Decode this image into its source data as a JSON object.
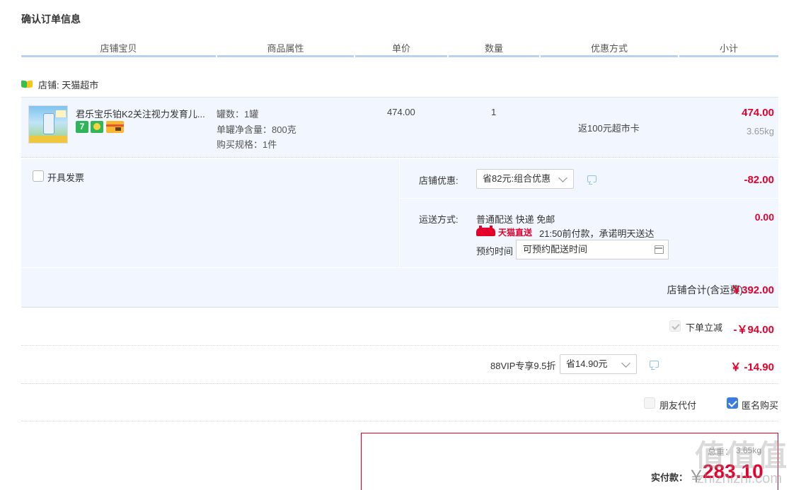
{
  "page_title": "确认订单信息",
  "columns": [
    "店铺宝贝",
    "商品属性",
    "单价",
    "数量",
    "优惠方式",
    "小计"
  ],
  "shop": {
    "label": "店铺: 天猫超市"
  },
  "item": {
    "title": "君乐宝乐铂K2关注视力发育儿...",
    "badge_text": "7",
    "attrs": [
      "罐数：1罐",
      "单罐净含量：800克",
      "购买规格：1件"
    ],
    "price": "474.00",
    "qty": "1",
    "promo": "返100元超市卡",
    "subtotal": "474.00",
    "weight": "3.65kg"
  },
  "invoice": {
    "label": "开具发票"
  },
  "shop_discount": {
    "label": "店铺优惠:",
    "select_value": "省82元:组合优惠",
    "amount": "-82.00"
  },
  "shipping": {
    "label": "运送方式:",
    "method": "普通配送 快递 免邮",
    "tmall_logo_text": "天猫直送",
    "promise": "21:50前付款，承诺明天送达",
    "appoint_label": "预约时间",
    "appoint_value": "可预约配送时间",
    "amount": "0.00"
  },
  "shop_total": {
    "label": "店铺合计(含运费)",
    "amount": "￥392.00"
  },
  "instant_discount": {
    "label": "下单立减",
    "amount": "-￥94.00"
  },
  "vip": {
    "label": "88VIP专享9.5折",
    "select_value": "省14.90元",
    "amount": "￥ -14.90"
  },
  "options": {
    "friend_pay": "朋友代付",
    "anonymous": "匿名购买"
  },
  "payment": {
    "weight_label": "总重：",
    "weight_value": "3.65kg",
    "label": "实付款：",
    "currency": "￥",
    "amount": "283.10"
  },
  "watermark": {
    "text": "值值值",
    "site": "zhizhizhi.com"
  },
  "colors": {
    "accent_red": "#e4002b",
    "panel_blue": "#f2f7ff",
    "header_line": "#b6d4f2",
    "check_blue": "#3b7ddd"
  }
}
